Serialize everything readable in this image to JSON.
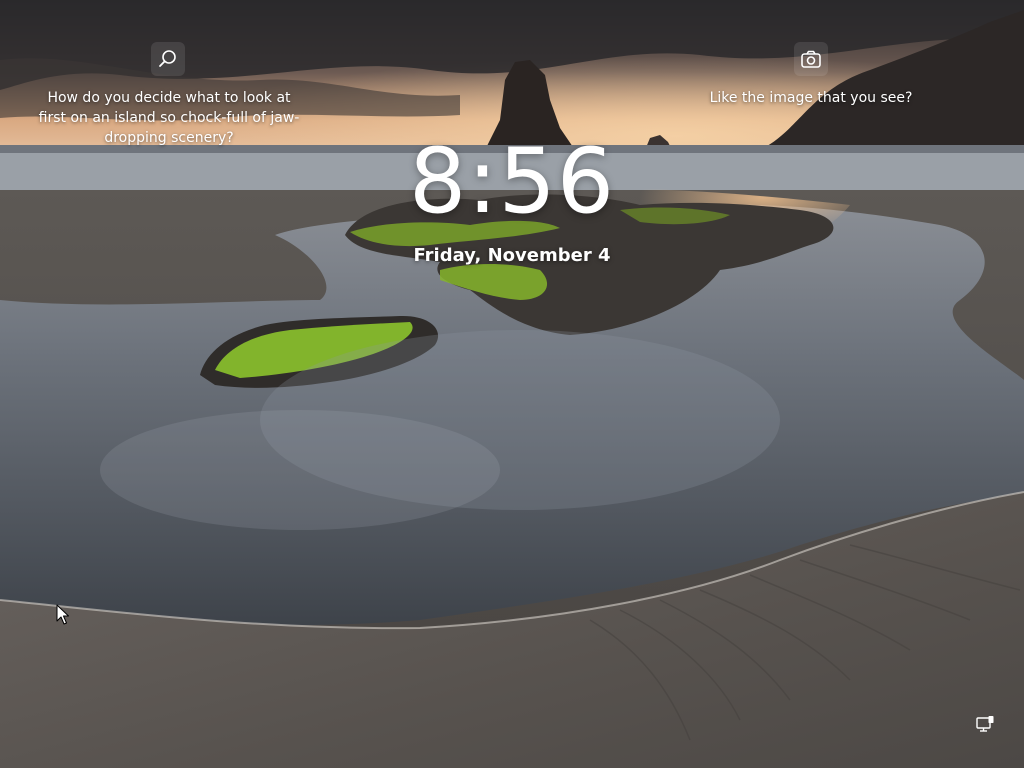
{
  "lockscreen": {
    "time": "8:56",
    "date": "Friday, November 4"
  },
  "spotlight": {
    "fact_text": "How do you decide what to look at first on an island so chock-full of jaw-dropping scenery?",
    "like_text": "Like the image that you see?",
    "search_icon": "search-icon",
    "camera_icon": "camera-icon"
  },
  "system_tray": {
    "network_icon": "network-icon"
  },
  "colors": {
    "text": "#ffffff",
    "moss": "#8bbf2a",
    "sky_glow": "#f2c9a0"
  }
}
